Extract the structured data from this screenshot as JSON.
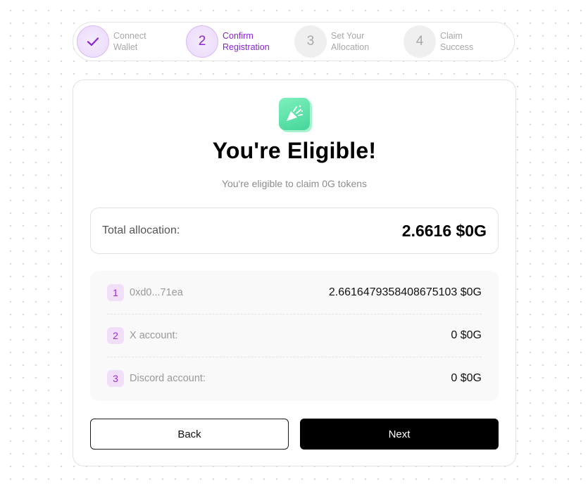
{
  "stepper": {
    "steps": [
      {
        "number": "",
        "line1": "Connect",
        "line2": "Wallet",
        "state": "done",
        "icon": "check-icon"
      },
      {
        "number": "2",
        "line1": "Confirm",
        "line2": "Registration",
        "state": "active"
      },
      {
        "number": "3",
        "line1": "Set Your",
        "line2": "Allocation",
        "state": "pending"
      },
      {
        "number": "4",
        "line1": "Claim",
        "line2": "Success",
        "state": "pending"
      }
    ]
  },
  "card": {
    "icon": "party-popper-icon",
    "title": "You're Eligible!",
    "subtitle": "You're eligible to claim 0G tokens",
    "total": {
      "label": "Total allocation:",
      "value": "2.6616 $0G"
    },
    "rows": [
      {
        "number": "1",
        "label": "0xd0...71ea",
        "value": "2.661647935840867510​3 $0G"
      },
      {
        "number": "2",
        "label": "X account:",
        "value": "0 $0G"
      },
      {
        "number": "3",
        "label": "Discord account:",
        "value": "0 $0G"
      }
    ],
    "back_label": "Back",
    "next_label": "Next"
  },
  "colors": {
    "accent": "#8a24d6",
    "icon_green": "#45d69a",
    "primary_button": "#000000"
  }
}
